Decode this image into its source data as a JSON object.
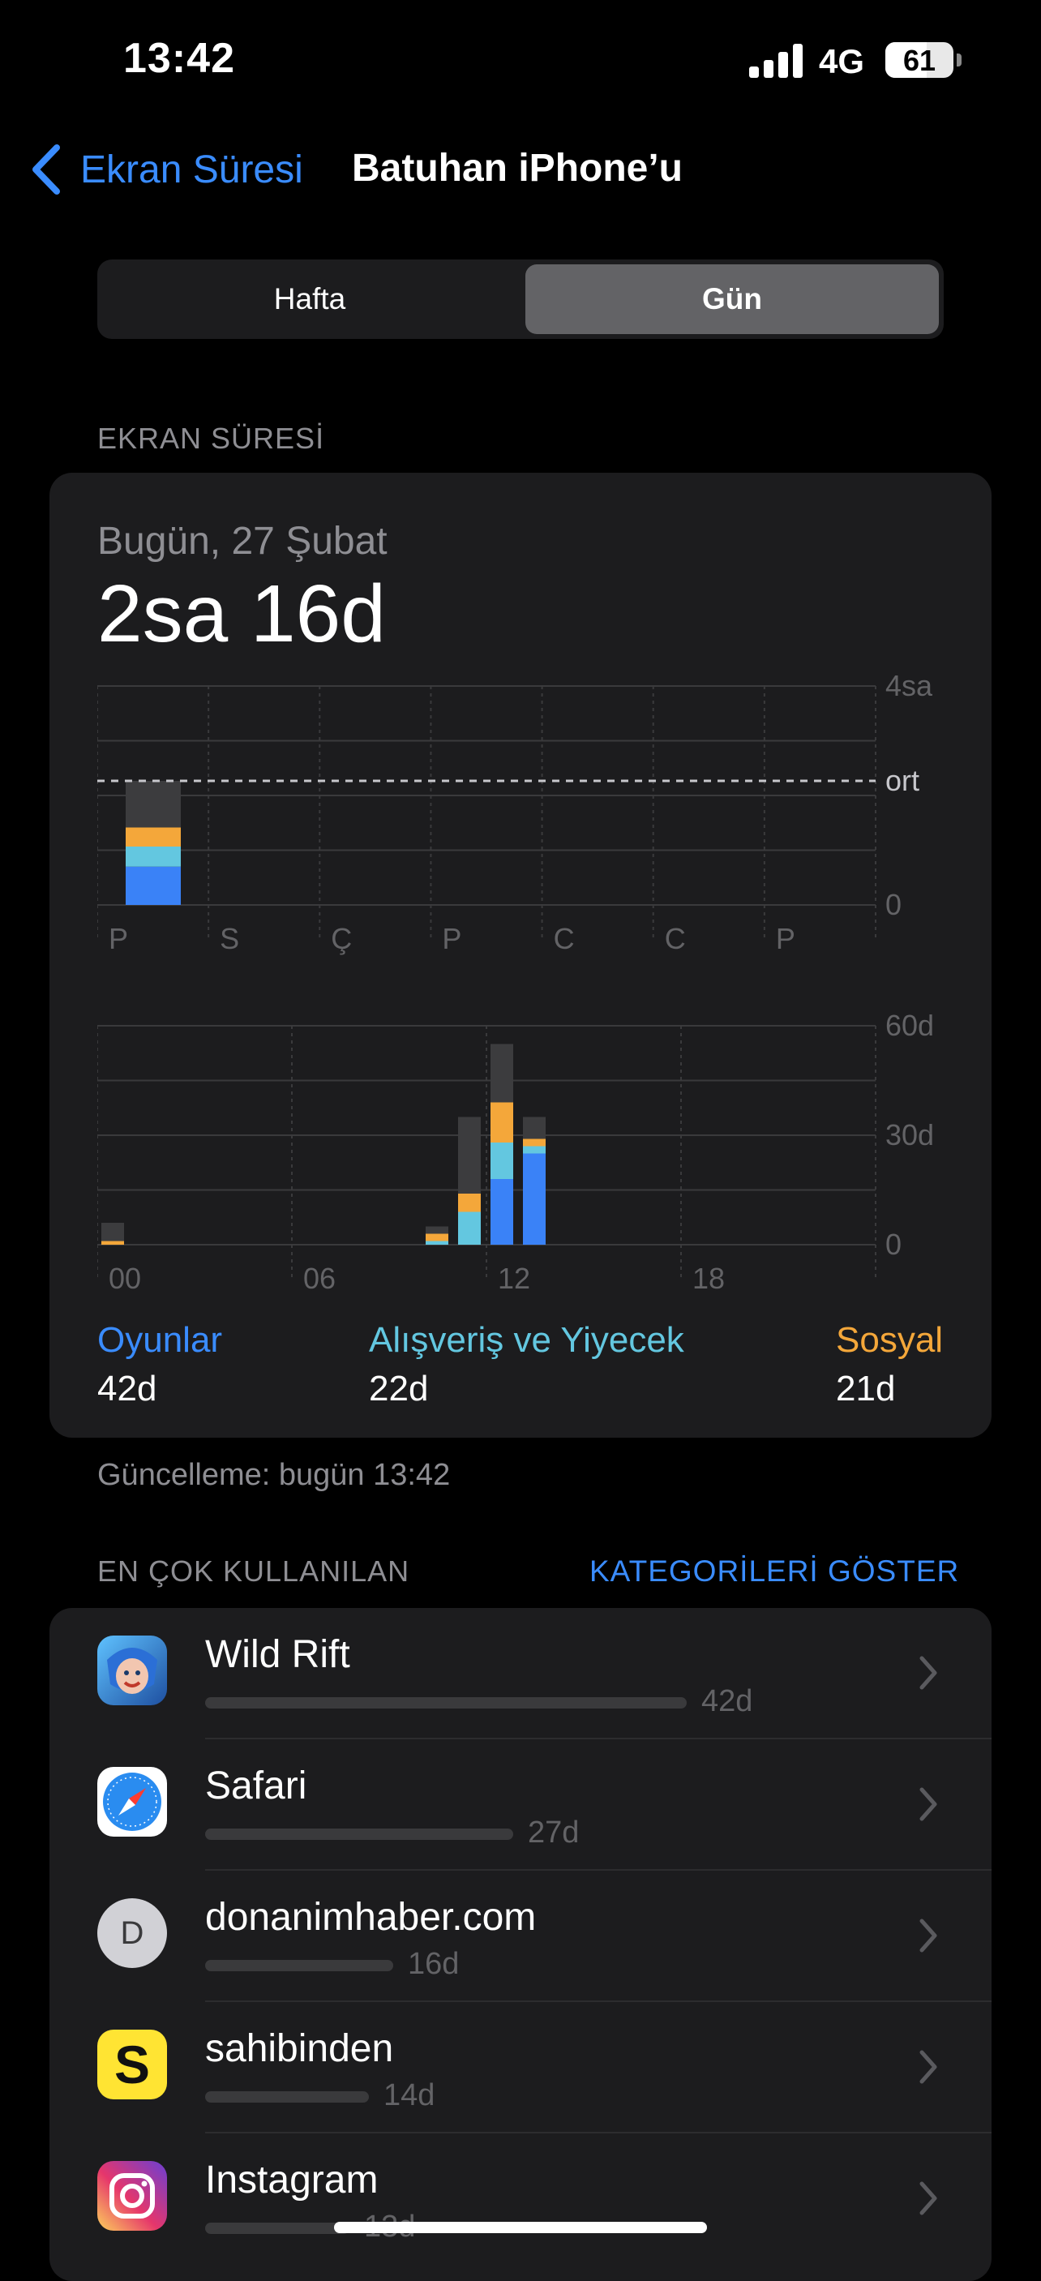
{
  "status": {
    "time": "13:42",
    "network": "4G",
    "battery": "61",
    "battery_level": 0.61
  },
  "nav": {
    "back_label": "Ekran Süresi",
    "title": "Batuhan iPhone’u"
  },
  "segment": {
    "week": "Hafta",
    "day": "Gün",
    "selected": "day"
  },
  "section": {
    "screen_time_label": "EKRAN SÜRESİ",
    "most_used_label": "EN ÇOK KULLANILAN",
    "show_categories": "KATEGORİLERİ GÖSTER"
  },
  "summary": {
    "date": "Bugün, 27 Şubat",
    "total": "2sa 16d",
    "updated": "Güncelleme: bugün 13:42"
  },
  "colors": {
    "games": "#3a82f7",
    "shopping": "#63c7e0",
    "social": "#f4a73a",
    "other": "#3c3c3e",
    "accent": "#3a8cff"
  },
  "chart_data": [
    {
      "type": "bar",
      "stacked": true,
      "categories": [
        "P",
        "S",
        "Ç",
        "P",
        "C",
        "C",
        "P"
      ],
      "y_tick_labels": [
        "4sa",
        "ort",
        "0"
      ],
      "ylim_minutes": [
        0,
        240
      ],
      "average_minutes": 136,
      "average_label": "ort",
      "series": [
        {
          "name": "Oyunlar",
          "key": "games",
          "values": [
            42,
            0,
            0,
            0,
            0,
            0,
            0
          ]
        },
        {
          "name": "Alışveriş ve Yiyecek",
          "key": "shopping",
          "values": [
            22,
            0,
            0,
            0,
            0,
            0,
            0
          ]
        },
        {
          "name": "Sosyal",
          "key": "social",
          "values": [
            21,
            0,
            0,
            0,
            0,
            0,
            0
          ]
        },
        {
          "key": "other",
          "values": [
            51,
            0,
            0,
            0,
            0,
            0,
            0
          ]
        }
      ]
    },
    {
      "type": "bar",
      "stacked": true,
      "x_tick_labels": [
        "00",
        "06",
        "12",
        "18"
      ],
      "y_tick_labels": [
        "60d",
        "30d",
        "0"
      ],
      "ylim_minutes": [
        0,
        60
      ],
      "hours": [
        0,
        10,
        11,
        12,
        13
      ],
      "series": [
        {
          "key": "games",
          "values": [
            0,
            0,
            0,
            18,
            25
          ]
        },
        {
          "key": "shopping",
          "values": [
            0,
            1,
            9,
            10,
            2
          ]
        },
        {
          "key": "social",
          "values": [
            1,
            2,
            5,
            11,
            2
          ]
        },
        {
          "key": "other",
          "values": [
            5,
            2,
            21,
            16,
            6
          ]
        }
      ]
    }
  ],
  "legend": [
    {
      "label": "Oyunlar",
      "value": "42d",
      "color": "#3a8cff"
    },
    {
      "label": "Alışveriş ve Yiyecek",
      "value": "22d",
      "color": "#63c7e0"
    },
    {
      "label": "Sosyal",
      "value": "21d",
      "color": "#f4a73a"
    }
  ],
  "apps": [
    {
      "name": "Wild Rift",
      "duration": "42d",
      "fraction": 1.0,
      "icon": "wild-rift-icon"
    },
    {
      "name": "Safari",
      "duration": "27d",
      "fraction": 0.64,
      "icon": "safari-icon"
    },
    {
      "name": "donanimhaber.com",
      "duration": "16d",
      "fraction": 0.39,
      "icon": "website-icon",
      "letter": "D"
    },
    {
      "name": "sahibinden",
      "duration": "14d",
      "fraction": 0.34,
      "icon": "sahibinden-icon",
      "letter": "S"
    },
    {
      "name": "Instagram",
      "duration": "13d",
      "fraction": 0.3,
      "icon": "instagram-icon"
    }
  ]
}
